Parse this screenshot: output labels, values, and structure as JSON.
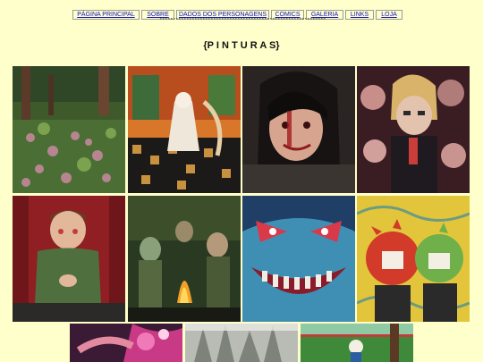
{
  "nav": {
    "items": [
      {
        "label": "PÁGINA PRINCIPAL"
      },
      {
        "label": "SOBRE"
      },
      {
        "label": "DADOS DOS PERSONAGENS"
      },
      {
        "label": "COMICS"
      },
      {
        "label": "GALERIA"
      },
      {
        "label": "LINKS"
      },
      {
        "label": "LOJA"
      }
    ],
    "divider": "***********************************************************************"
  },
  "page": {
    "title": "{P I N T U R A S}"
  },
  "gallery": {
    "paintings": [
      {
        "name": "painting-forest-pond",
        "icon": "painting-image"
      },
      {
        "name": "painting-ghost-girl-chair",
        "icon": "painting-image"
      },
      {
        "name": "painting-dark-haired-smile",
        "icon": "painting-image"
      },
      {
        "name": "painting-crowd-blonde",
        "icon": "painting-image"
      },
      {
        "name": "painting-man-green-jacket",
        "icon": "painting-image"
      },
      {
        "name": "painting-campfire-soldiers",
        "icon": "painting-image"
      },
      {
        "name": "painting-blue-grin",
        "icon": "painting-image"
      },
      {
        "name": "painting-red-green-heads",
        "icon": "painting-image"
      },
      {
        "name": "painting-hand-pink-burst",
        "icon": "painting-image"
      },
      {
        "name": "painting-grey-trees",
        "icon": "painting-image"
      },
      {
        "name": "painting-forest-character",
        "icon": "painting-image"
      }
    ]
  }
}
